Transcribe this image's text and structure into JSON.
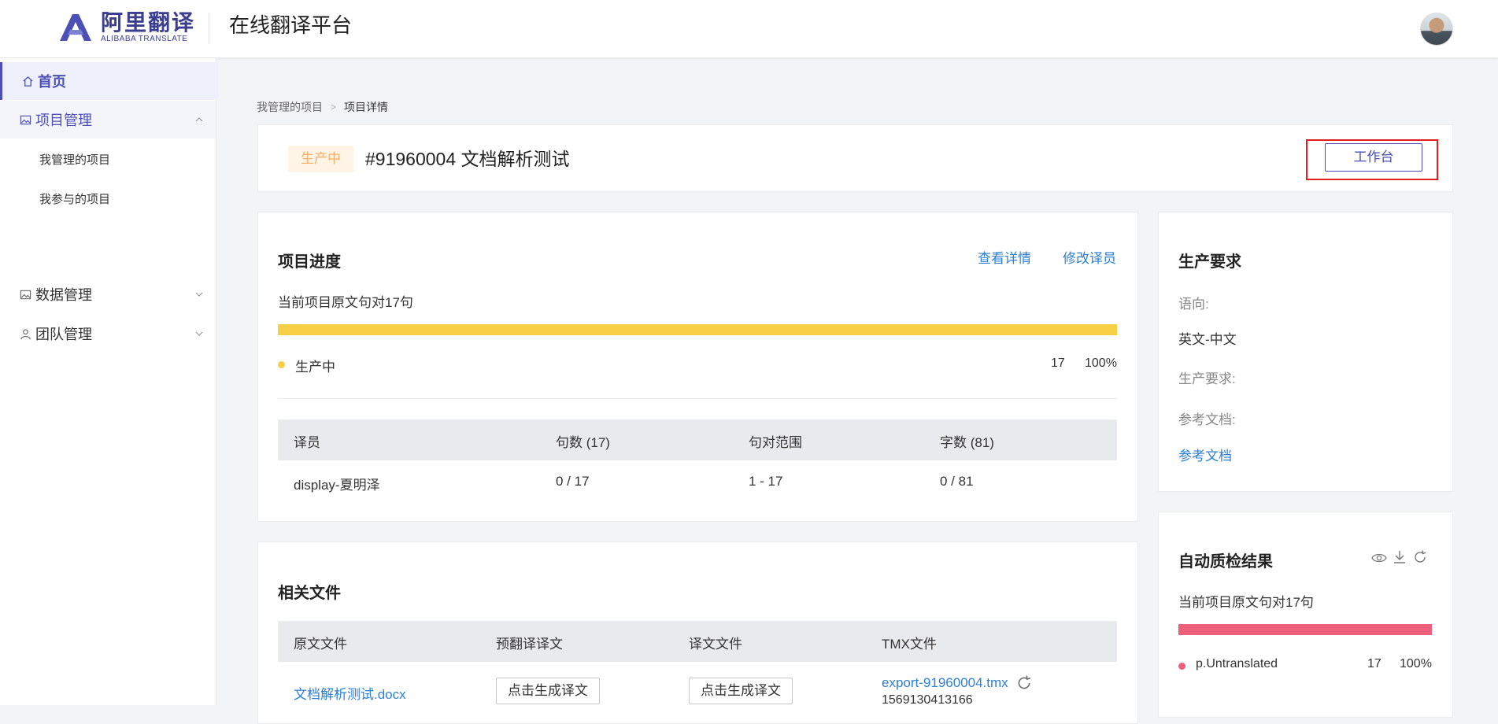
{
  "header": {
    "logo_cn": "阿里翻译",
    "logo_en": "ALIBABA TRANSLATE",
    "platform_title": "在线翻译平台"
  },
  "sidebar": {
    "home": "首页",
    "project_mgmt": "项目管理",
    "my_managed": "我管理的项目",
    "my_joined": "我参与的项目",
    "data_mgmt": "数据管理",
    "team_mgmt": "团队管理"
  },
  "breadcrumb": {
    "parent": "我管理的项目",
    "current": "项目详情"
  },
  "project": {
    "status": "生产中",
    "title": "#91960004 文档解析测试",
    "workbench_button": "工作台"
  },
  "progress": {
    "title": "项目进度",
    "view_details": "查看详情",
    "modify_translator": "修改译员",
    "summary": "当前项目原文句对17句",
    "bar_fraction": 1.0,
    "legend_label": "生产中",
    "legend_count": "17",
    "legend_percent": "100%",
    "table_headers": [
      "译员",
      "句数 (17)",
      "句对范围",
      "字数 (81)"
    ],
    "rows": [
      [
        "display-夏明泽",
        "0 / 17",
        "1 - 17",
        "0 / 81"
      ]
    ]
  },
  "requirements": {
    "title": "生产要求",
    "language_label": "语向:",
    "language_value": "英文-中文",
    "req_label": "生产要求:",
    "ref_label": "参考文档:",
    "ref_link": "参考文档"
  },
  "qa": {
    "title": "自动质检结果",
    "summary": "当前项目原文句对17句",
    "bar_fraction": 1.0,
    "legend_label": "p.Untranslated",
    "legend_count": "17",
    "legend_percent": "100%"
  },
  "files": {
    "title": "相关文件",
    "headers": [
      "原文文件",
      "预翻译译文",
      "译文文件",
      "TMX文件"
    ],
    "source_file": "文档解析测试.docx",
    "pretranslate_button": "点击生成译文",
    "translation_button": "点击生成译文",
    "tmx_file": "export-91960004.tmx",
    "tmx_id": "1569130413166"
  },
  "colors": {
    "accent": "#4b4fb6",
    "link": "#2d7fd3",
    "progress_bar": "#f7cf45",
    "qa_bar": "#ee5f7b",
    "status_tag_bg": "#fff4e6",
    "status_tag_text": "#f5b06a",
    "highlight": "#e02020"
  }
}
